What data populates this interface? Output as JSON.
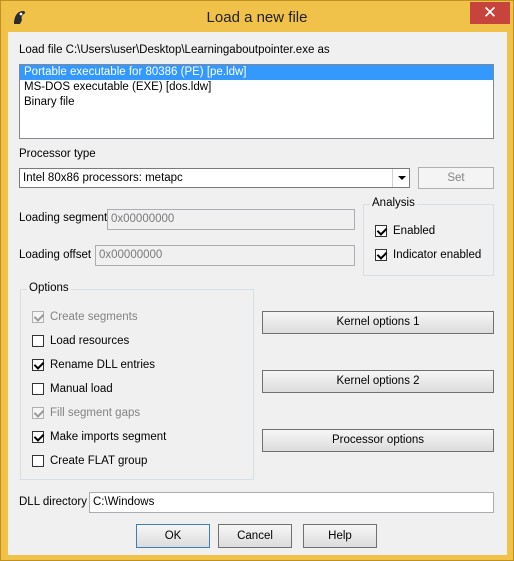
{
  "window": {
    "title": "Load a new file",
    "close_label": "✕"
  },
  "load_file_label": "Load file C:\\Users\\user\\Desktop\\Learningaboutpointer.exe as",
  "loader_list": [
    {
      "label": "Portable executable for 80386 (PE) [pe.ldw]",
      "selected": true
    },
    {
      "label": "MS-DOS executable (EXE) [dos.ldw]",
      "selected": false
    },
    {
      "label": "Binary file",
      "selected": false
    }
  ],
  "processor": {
    "label": "Processor type",
    "selected": "Intel 80x86 processors: metapc",
    "set_label": "Set"
  },
  "loading": {
    "segment_label": "Loading segment",
    "segment_value": "0x00000000",
    "offset_label": "Loading offset",
    "offset_value": "0x00000000"
  },
  "analysis": {
    "legend": "Analysis",
    "enabled_label": "Enabled",
    "enabled_checked": true,
    "indicator_label": "Indicator enabled",
    "indicator_checked": true
  },
  "options": {
    "legend": "Options",
    "items": [
      {
        "label": "Create segments",
        "checked": true,
        "disabled": true
      },
      {
        "label": "Load resources",
        "checked": false,
        "disabled": false
      },
      {
        "label": "Rename DLL entries",
        "checked": true,
        "disabled": false
      },
      {
        "label": "Manual load",
        "checked": false,
        "disabled": false
      },
      {
        "label": "Fill segment gaps",
        "checked": true,
        "disabled": true
      },
      {
        "label": "Make imports segment",
        "checked": true,
        "disabled": false
      },
      {
        "label": "Create FLAT group",
        "checked": false,
        "disabled": false
      }
    ]
  },
  "buttons": {
    "kernel1": "Kernel options 1",
    "kernel2": "Kernel options 2",
    "processor_options": "Processor options",
    "ok": "OK",
    "cancel": "Cancel",
    "help": "Help"
  },
  "dll": {
    "label": "DLL directory",
    "value": "C:\\Windows"
  }
}
